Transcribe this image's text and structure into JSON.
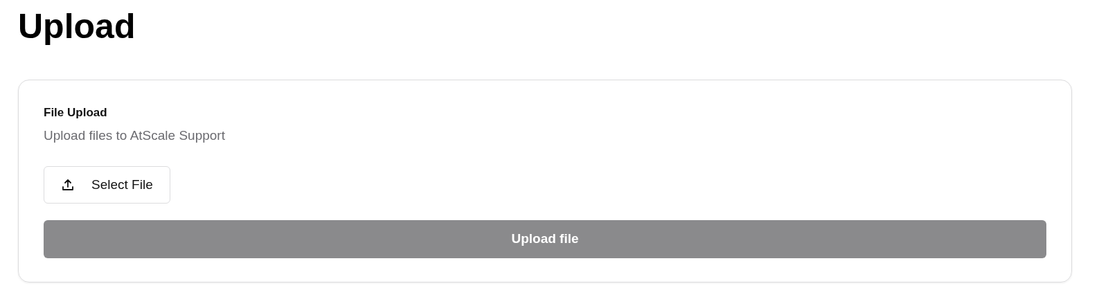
{
  "page_title": "Upload",
  "card": {
    "title": "File Upload",
    "subtitle": "Upload files to AtScale Support",
    "select_button": {
      "label": "Select File"
    },
    "upload_button": {
      "label": "Upload file",
      "disabled": true
    }
  }
}
